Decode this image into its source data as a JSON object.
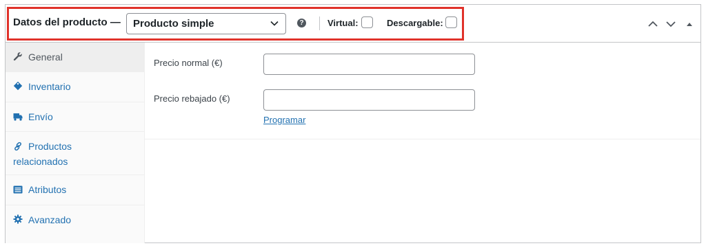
{
  "header": {
    "title": "Datos del producto —",
    "product_type": {
      "selected": "Producto simple"
    },
    "help_icon": "?",
    "virtual_label": "Virtual:",
    "downloadable_label": "Descargable:"
  },
  "tabs": [
    {
      "label": "General",
      "icon": "wrench-icon",
      "active": true
    },
    {
      "label": "Inventario",
      "icon": "tag-icon",
      "active": false
    },
    {
      "label": "Envío",
      "icon": "truck-icon",
      "active": false
    },
    {
      "label_line1": "Productos",
      "label_line2": "relacionados",
      "icon": "link-icon",
      "active": false
    },
    {
      "label": "Atributos",
      "icon": "list-icon",
      "active": false
    },
    {
      "label": "Avanzado",
      "icon": "gear-icon",
      "active": false
    }
  ],
  "general": {
    "regular_price_label": "Precio normal (€)",
    "regular_price_value": "",
    "sale_price_label": "Precio rebajado (€)",
    "sale_price_value": "",
    "schedule_link": "Programar"
  },
  "colors": {
    "accent": "#2271b1",
    "highlight": "#e0322a"
  }
}
